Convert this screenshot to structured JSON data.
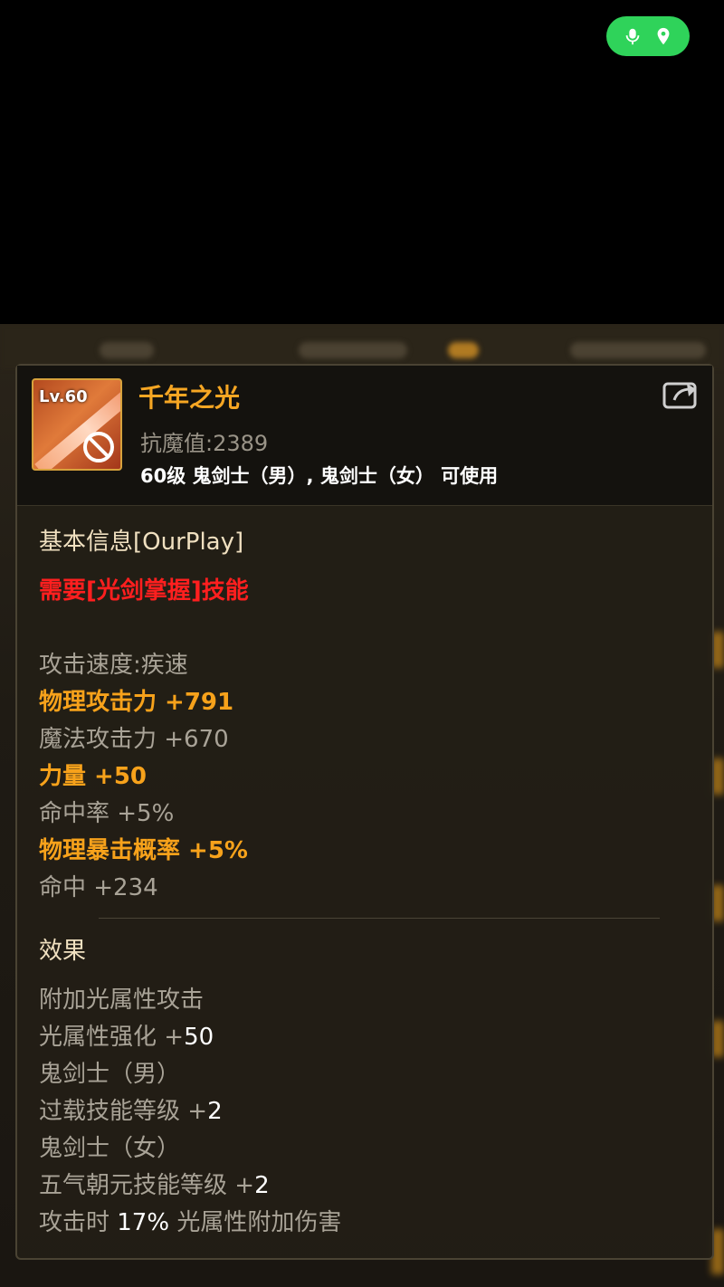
{
  "item": {
    "level_label": "Lv.60",
    "name": "千年之光",
    "sub_stat": "抗魔值:2389",
    "requirement": "60级 鬼剑士（男）, 鬼剑士（女） 可使用"
  },
  "basic": {
    "title": "基本信息[OurPlay]",
    "skill_req": "需要[光剑掌握]技能",
    "stats": [
      {
        "label": "攻击速度:疾速"
      },
      {
        "label": "物理攻击力 +791"
      },
      {
        "label": "魔法攻击力 +670"
      },
      {
        "label": "力量 +50"
      },
      {
        "label": "命中率 +5%"
      },
      {
        "label": "物理暴击概率 +5%"
      },
      {
        "label": "命中 +234"
      }
    ]
  },
  "effects": {
    "title": "效果",
    "lines": [
      {
        "label": "附加光属性攻击"
      },
      {
        "prefix": "光属性强化 +",
        "value": "50"
      },
      {
        "label": "鬼剑士（男）"
      },
      {
        "prefix": "过载技能等级 +",
        "value": "2"
      },
      {
        "label": "鬼剑士（女）"
      },
      {
        "prefix": "五气朝元技能等级 +",
        "value": "2"
      },
      {
        "prefix": "攻击时 ",
        "value": "17%",
        "suffix": " 光属性附加伤害"
      }
    ]
  },
  "icons": {
    "mic": "microphone-icon",
    "location": "location-pin-icon",
    "share": "share-icon",
    "prohibit": "prohibited-icon"
  },
  "colors": {
    "pill": "#2fd35a",
    "name": "#f6a623",
    "highlight": "#f7a21b",
    "warning": "#ff1f1f"
  }
}
